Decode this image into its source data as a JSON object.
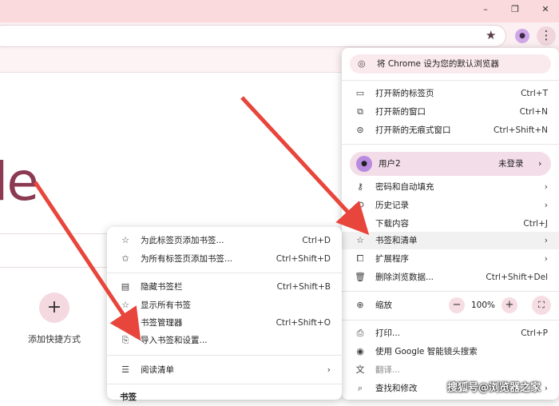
{
  "window": {
    "controls": {
      "minimize": "–",
      "restore": "❐",
      "close": "✕"
    }
  },
  "toolbar": {
    "profile_initial": "🂠",
    "menu_glyph": "⋮"
  },
  "ntp": {
    "logo_fragment": "le",
    "shortcut_plus": "+",
    "shortcut_label": "添加快捷方式"
  },
  "main_menu": {
    "promo_label": "将 Chrome 设为您的默认浏览器",
    "new_tab": {
      "label": "打开新的标签页",
      "shortcut": "Ctrl+T"
    },
    "new_window": {
      "label": "打开新的窗口",
      "shortcut": "Ctrl+N"
    },
    "incognito": {
      "label": "打开新的无痕式窗口",
      "shortcut": "Ctrl+Shift+N"
    },
    "profile": {
      "name": "用户2",
      "status": "未登录",
      "arrow": "›"
    },
    "passwords": {
      "label": "密码和自动填充",
      "arrow": "›"
    },
    "history": {
      "label": "历史记录",
      "arrow": "›"
    },
    "downloads": {
      "label": "下载内容",
      "shortcut": "Ctrl+J"
    },
    "bookmarks": {
      "label": "书签和清单",
      "arrow": "›"
    },
    "extensions": {
      "label": "扩展程序",
      "arrow": "›"
    },
    "clear_data": {
      "label": "删除浏览数据...",
      "shortcut": "Ctrl+Shift+Del"
    },
    "zoom": {
      "label": "缩放",
      "minus": "−",
      "value": "100%",
      "plus": "+",
      "fullscreen": "⛶"
    },
    "print": {
      "label": "打印...",
      "shortcut": "Ctrl+P"
    },
    "lens": {
      "label": "使用 Google 智能镜头搜索"
    },
    "translate": {
      "label": "翻译..."
    },
    "find": {
      "label": "查找和修改",
      "arrow": "›"
    }
  },
  "bookmarks_submenu": {
    "bookmark_tab": {
      "label": "为此标签页添加书签...",
      "shortcut": "Ctrl+D"
    },
    "bookmark_all": {
      "label": "为所有标签页添加书签...",
      "shortcut": "Ctrl+Shift+D"
    },
    "hide_bar": {
      "label": "隐藏书签栏",
      "shortcut": "Ctrl+Shift+B"
    },
    "show_all": {
      "label": "显示所有书签"
    },
    "manager": {
      "label": "书签管理器",
      "shortcut": "Ctrl+Shift+O"
    },
    "import": {
      "label": "导入书签和设置..."
    },
    "reading_list": {
      "label": "阅读清单",
      "arrow": "›"
    },
    "bottom_label": "书签"
  },
  "watermark": "搜狐号@浏览器之家",
  "colors": {
    "accent": "#8b3a52",
    "titlebar": "#fadadd",
    "arrow": "#e8453c"
  }
}
